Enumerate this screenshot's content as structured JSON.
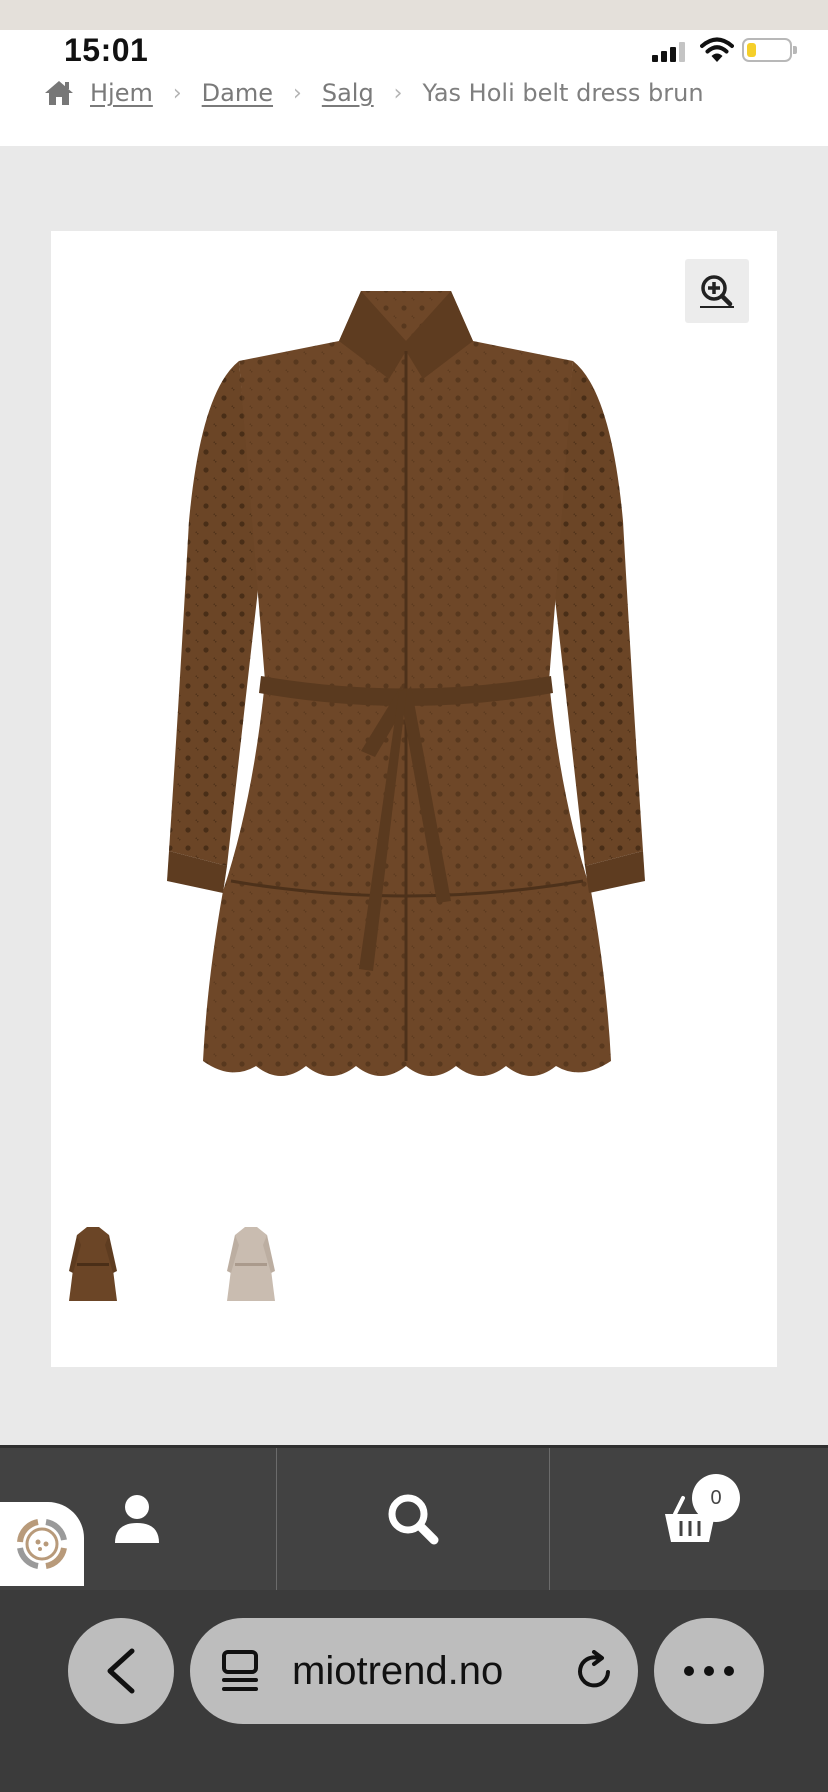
{
  "status_bar": {
    "time": "15:01",
    "battery_level": 0.22
  },
  "breadcrumb": {
    "items": [
      "Hjem",
      "Dame",
      "Salg"
    ],
    "current": "Yas Holi belt dress brun"
  },
  "product_gallery": {
    "thumbnails": [
      "dress-brown-thumbnail",
      "dress-beige-thumbnail"
    ]
  },
  "bottom_nav": {
    "cart_count": "0",
    "items": [
      "account-icon",
      "search-icon",
      "cart-icon"
    ]
  },
  "browser": {
    "url": "miotrend.no"
  },
  "colors": {
    "dress_brown": "#6b4526",
    "nav_bg": "#424242",
    "browser_bg": "#3b3b3b",
    "pill_bg": "#bdbdbd"
  }
}
